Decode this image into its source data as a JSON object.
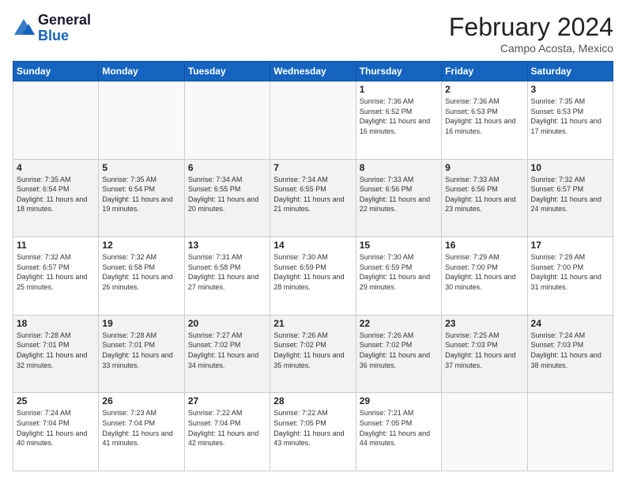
{
  "header": {
    "logo_line1": "General",
    "logo_line2": "Blue",
    "month_year": "February 2024",
    "location": "Campo Acosta, Mexico"
  },
  "days_of_week": [
    "Sunday",
    "Monday",
    "Tuesday",
    "Wednesday",
    "Thursday",
    "Friday",
    "Saturday"
  ],
  "weeks": [
    [
      {
        "day": "",
        "info": ""
      },
      {
        "day": "",
        "info": ""
      },
      {
        "day": "",
        "info": ""
      },
      {
        "day": "",
        "info": ""
      },
      {
        "day": "1",
        "info": "Sunrise: 7:36 AM\nSunset: 6:52 PM\nDaylight: 11 hours and 16 minutes."
      },
      {
        "day": "2",
        "info": "Sunrise: 7:36 AM\nSunset: 6:53 PM\nDaylight: 11 hours and 16 minutes."
      },
      {
        "day": "3",
        "info": "Sunrise: 7:35 AM\nSunset: 6:53 PM\nDaylight: 11 hours and 17 minutes."
      }
    ],
    [
      {
        "day": "4",
        "info": "Sunrise: 7:35 AM\nSunset: 6:54 PM\nDaylight: 11 hours and 18 minutes."
      },
      {
        "day": "5",
        "info": "Sunrise: 7:35 AM\nSunset: 6:54 PM\nDaylight: 11 hours and 19 minutes."
      },
      {
        "day": "6",
        "info": "Sunrise: 7:34 AM\nSunset: 6:55 PM\nDaylight: 11 hours and 20 minutes."
      },
      {
        "day": "7",
        "info": "Sunrise: 7:34 AM\nSunset: 6:55 PM\nDaylight: 11 hours and 21 minutes."
      },
      {
        "day": "8",
        "info": "Sunrise: 7:33 AM\nSunset: 6:56 PM\nDaylight: 11 hours and 22 minutes."
      },
      {
        "day": "9",
        "info": "Sunrise: 7:33 AM\nSunset: 6:56 PM\nDaylight: 11 hours and 23 minutes."
      },
      {
        "day": "10",
        "info": "Sunrise: 7:32 AM\nSunset: 6:57 PM\nDaylight: 11 hours and 24 minutes."
      }
    ],
    [
      {
        "day": "11",
        "info": "Sunrise: 7:32 AM\nSunset: 6:57 PM\nDaylight: 11 hours and 25 minutes."
      },
      {
        "day": "12",
        "info": "Sunrise: 7:32 AM\nSunset: 6:58 PM\nDaylight: 11 hours and 26 minutes."
      },
      {
        "day": "13",
        "info": "Sunrise: 7:31 AM\nSunset: 6:58 PM\nDaylight: 11 hours and 27 minutes."
      },
      {
        "day": "14",
        "info": "Sunrise: 7:30 AM\nSunset: 6:59 PM\nDaylight: 11 hours and 28 minutes."
      },
      {
        "day": "15",
        "info": "Sunrise: 7:30 AM\nSunset: 6:59 PM\nDaylight: 11 hours and 29 minutes."
      },
      {
        "day": "16",
        "info": "Sunrise: 7:29 AM\nSunset: 7:00 PM\nDaylight: 11 hours and 30 minutes."
      },
      {
        "day": "17",
        "info": "Sunrise: 7:29 AM\nSunset: 7:00 PM\nDaylight: 11 hours and 31 minutes."
      }
    ],
    [
      {
        "day": "18",
        "info": "Sunrise: 7:28 AM\nSunset: 7:01 PM\nDaylight: 11 hours and 32 minutes."
      },
      {
        "day": "19",
        "info": "Sunrise: 7:28 AM\nSunset: 7:01 PM\nDaylight: 11 hours and 33 minutes."
      },
      {
        "day": "20",
        "info": "Sunrise: 7:27 AM\nSunset: 7:02 PM\nDaylight: 11 hours and 34 minutes."
      },
      {
        "day": "21",
        "info": "Sunrise: 7:26 AM\nSunset: 7:02 PM\nDaylight: 11 hours and 35 minutes."
      },
      {
        "day": "22",
        "info": "Sunrise: 7:26 AM\nSunset: 7:02 PM\nDaylight: 11 hours and 36 minutes."
      },
      {
        "day": "23",
        "info": "Sunrise: 7:25 AM\nSunset: 7:03 PM\nDaylight: 11 hours and 37 minutes."
      },
      {
        "day": "24",
        "info": "Sunrise: 7:24 AM\nSunset: 7:03 PM\nDaylight: 11 hours and 38 minutes."
      }
    ],
    [
      {
        "day": "25",
        "info": "Sunrise: 7:24 AM\nSunset: 7:04 PM\nDaylight: 11 hours and 40 minutes."
      },
      {
        "day": "26",
        "info": "Sunrise: 7:23 AM\nSunset: 7:04 PM\nDaylight: 11 hours and 41 minutes."
      },
      {
        "day": "27",
        "info": "Sunrise: 7:22 AM\nSunset: 7:04 PM\nDaylight: 11 hours and 42 minutes."
      },
      {
        "day": "28",
        "info": "Sunrise: 7:22 AM\nSunset: 7:05 PM\nDaylight: 11 hours and 43 minutes."
      },
      {
        "day": "29",
        "info": "Sunrise: 7:21 AM\nSunset: 7:05 PM\nDaylight: 11 hours and 44 minutes."
      },
      {
        "day": "",
        "info": ""
      },
      {
        "day": "",
        "info": ""
      }
    ]
  ]
}
